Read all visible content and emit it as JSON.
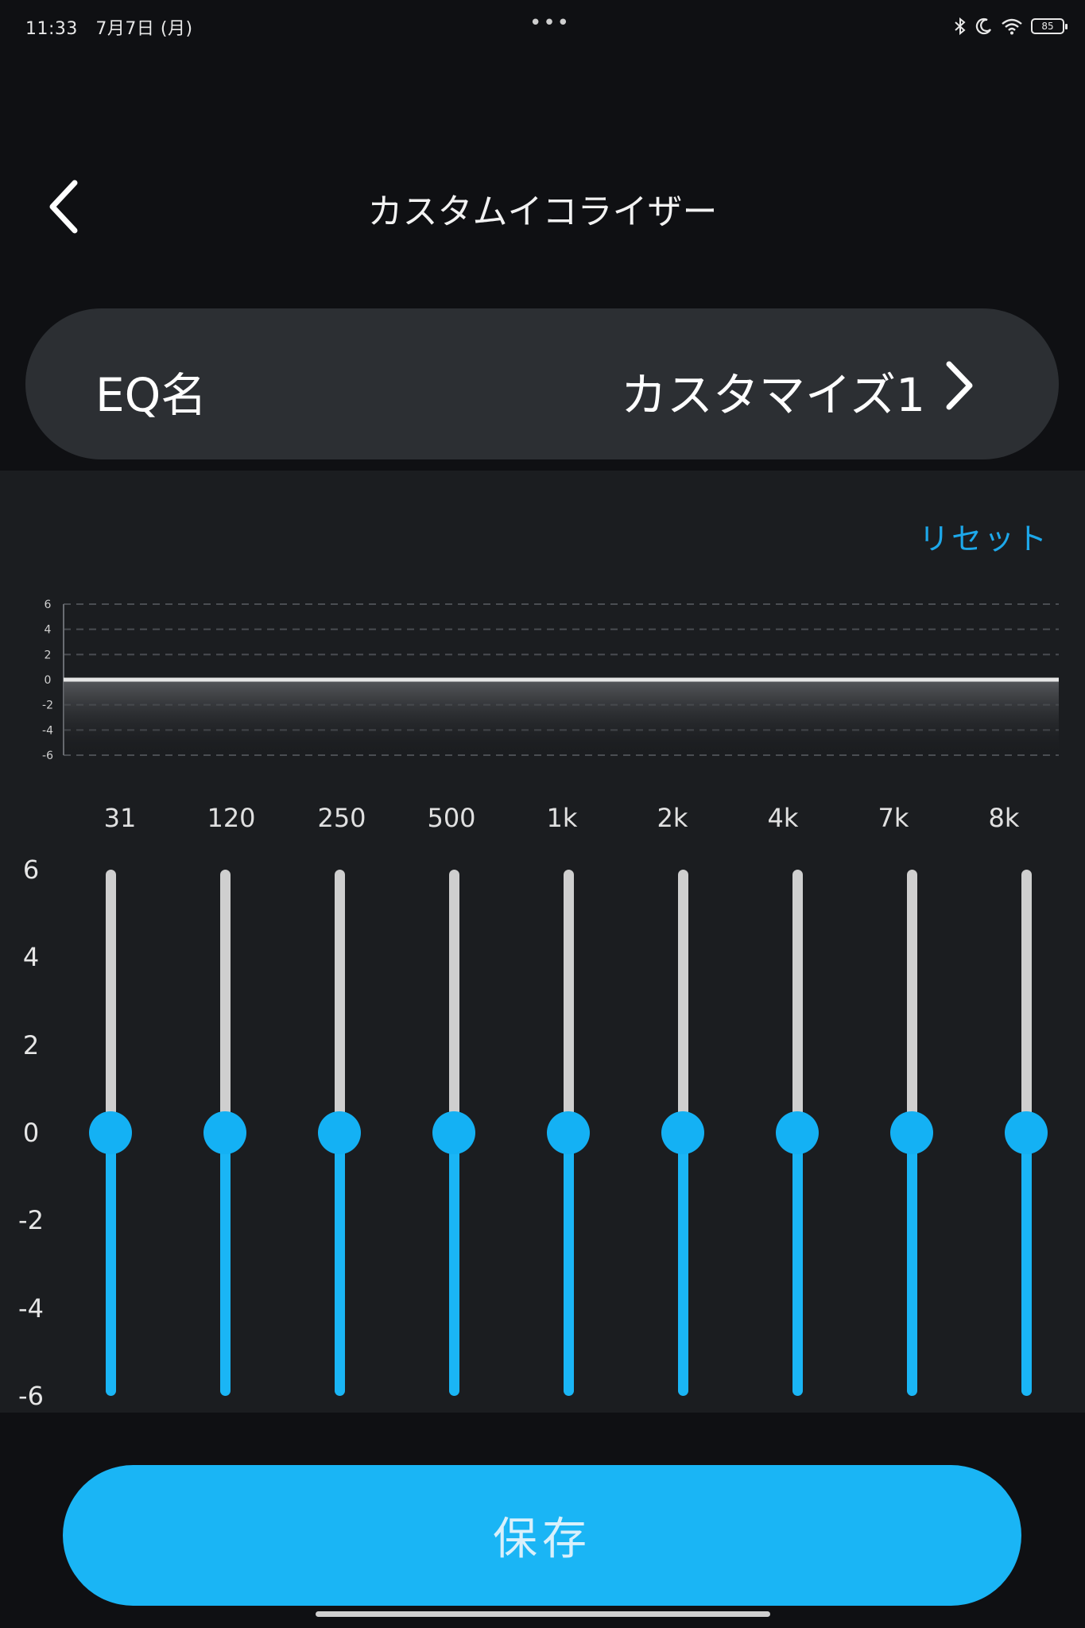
{
  "status_bar": {
    "time": "11:33",
    "date": "7月7日 (月)",
    "dots": "•••",
    "battery": "85",
    "icons": [
      "bluetooth-icon",
      "moon-icon",
      "wifi-icon",
      "battery-icon"
    ]
  },
  "header": {
    "title": "カスタムイコライザー",
    "back_icon": "chevron-left-icon"
  },
  "eq_name": {
    "label": "EQ名",
    "value": "カスタマイズ1",
    "icon": "chevron-right-icon"
  },
  "reset_label": "リセット",
  "graph": {
    "db_ticks": [
      "6",
      "4",
      "2",
      "0",
      "-2",
      "-4",
      "-6"
    ]
  },
  "bands": [
    {
      "freq": "31",
      "gain": 0
    },
    {
      "freq": "120",
      "gain": 0
    },
    {
      "freq": "250",
      "gain": 0
    },
    {
      "freq": "500",
      "gain": 0
    },
    {
      "freq": "1k",
      "gain": 0
    },
    {
      "freq": "2k",
      "gain": 0
    },
    {
      "freq": "4k",
      "gain": 0
    },
    {
      "freq": "7k",
      "gain": 0
    },
    {
      "freq": "8k",
      "gain": 0
    }
  ],
  "slider_scale": [
    "6",
    "4",
    "2",
    "0",
    "-2",
    "-4",
    "-6"
  ],
  "gain_range": [
    -6,
    6
  ],
  "save_label": "保存",
  "colors": {
    "accent": "#1ab5f5",
    "panel": "#1b1d20",
    "background": "#0f1013",
    "card": "#2c2f33"
  }
}
